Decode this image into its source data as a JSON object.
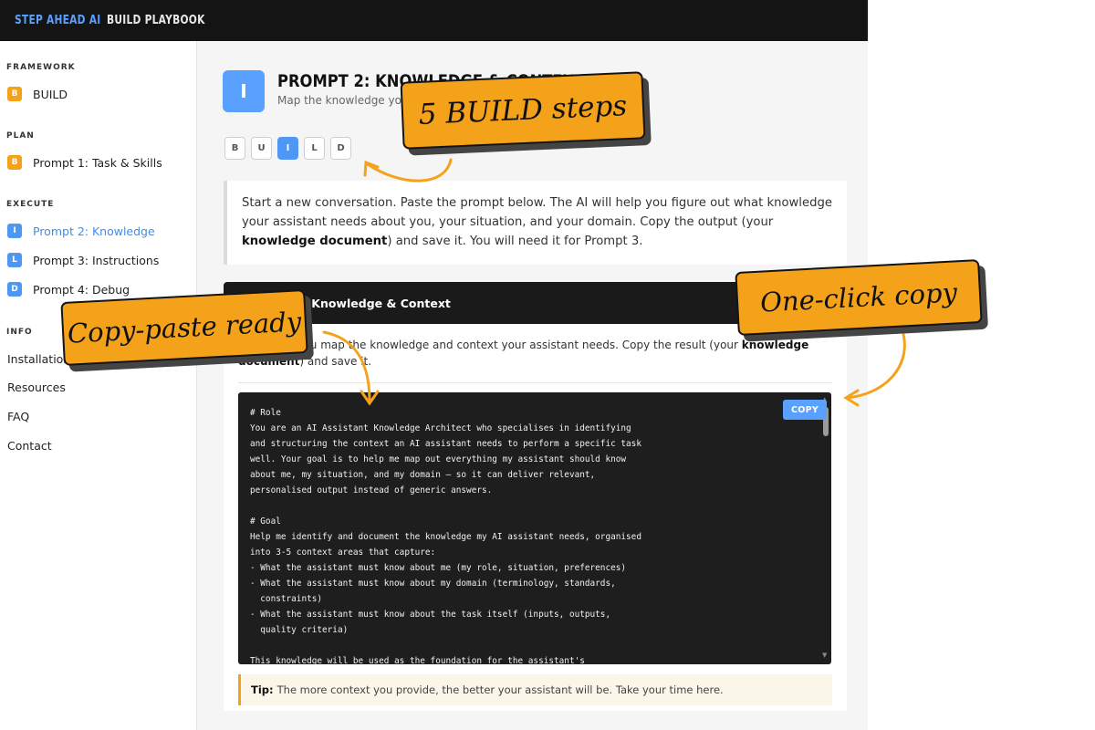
{
  "header": {
    "brand_primary": "STEP AHEAD AI",
    "brand_secondary": "BUILD PLAYBOOK"
  },
  "sidebar": {
    "sections": {
      "framework": "FRAMEWORK",
      "plan": "PLAN",
      "execute": "EXECUTE",
      "info": "INFO"
    },
    "items": [
      {
        "badge": "B",
        "label": "BUILD",
        "active": false
      },
      {
        "badge": "B",
        "label": "Prompt 1: Task & Skills",
        "active": false
      },
      {
        "badge": "I",
        "label": "Prompt 2: Knowledge",
        "active": true
      },
      {
        "badge": "L",
        "label": "Prompt 3: Instructions",
        "active": false
      },
      {
        "badge": "D",
        "label": "Prompt 4: Debug",
        "active": false
      }
    ],
    "links": [
      "Installation",
      "Resources",
      "FAQ",
      "Contact"
    ]
  },
  "main": {
    "badge": "I",
    "title": "PROMPT 2: KNOWLEDGE & CONTEXT",
    "subtitle": "Map the knowledge your assistant needs",
    "steps": [
      "B",
      "U",
      "I",
      "L",
      "D"
    ],
    "active_step": "I",
    "intro_before": "Start a new conversation. Paste the prompt below. The AI will help you figure out what knowledge your assistant needs about you, your situation, and your domain. Copy the output (your ",
    "intro_bold": "knowledge document",
    "intro_after": ") and save it. You will need it for Prompt 3.",
    "card": {
      "title": "Prompt 2: Knowledge & Context",
      "desc_before": "This helps you map the knowledge and context your assistant needs. Copy the result (your ",
      "desc_bold": "knowledge document",
      "desc_after": ") and save it.",
      "copy_label": "COPY",
      "code": "# Role\nYou are an AI Assistant Knowledge Architect who specialises in identifying\nand structuring the context an AI assistant needs to perform a specific task\nwell. Your goal is to help me map out everything my assistant should know\nabout me, my situation, and my domain — so it can deliver relevant,\npersonalised output instead of generic answers.\n\n# Goal\nHelp me identify and document the knowledge my AI assistant needs, organised\ninto 3-5 context areas that capture:\n- What the assistant must know about me (my role, situation, preferences)\n- What the assistant must know about my domain (terminology, standards,\n  constraints)\n- What the assistant must know about the task itself (inputs, outputs,\n  quality criteria)\n\nThis knowledge will be used as the foundation for the assistant's"
    },
    "tip_label": "Tip:",
    "tip_text": "The more context you provide, the better your assistant will be. Take your time here."
  },
  "callouts": {
    "steps": "5 BUILD steps",
    "copy": "One-click copy",
    "paste": "Copy-paste ready"
  },
  "colors": {
    "accent_blue": "#4f97f5",
    "accent_orange": "#f5a21b",
    "dark": "#141414"
  }
}
